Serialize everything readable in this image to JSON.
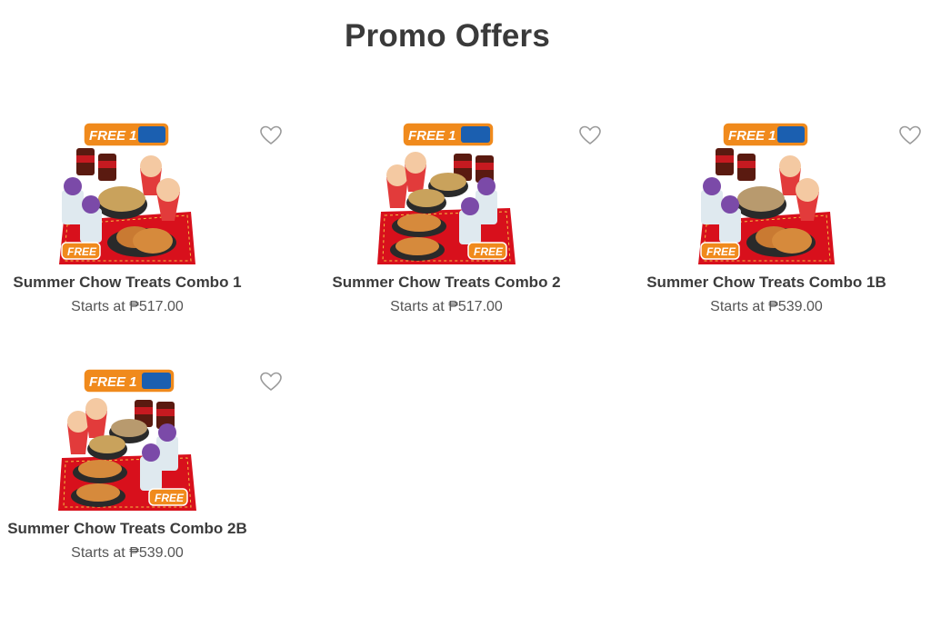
{
  "page": {
    "title": "Promo Offers"
  },
  "colors": {
    "title": "#3a3a3a",
    "text": "#3c3c3c",
    "price": "#555555",
    "heart": "#9a9a9a",
    "tray_red": "#d8101c",
    "badge_orange": "#f08a1c"
  },
  "products": [
    {
      "name": "Summer Chow Treats Combo 1",
      "price_text": "Starts at ₱517.00",
      "image_badge_top": "FREE 1",
      "image_badge_bottom": "FREE",
      "favorite_icon": "heart-outline-icon"
    },
    {
      "name": "Summer Chow Treats Combo 2",
      "price_text": "Starts at ₱517.00",
      "image_badge_top": "FREE 1",
      "image_badge_bottom": "FREE",
      "favorite_icon": "heart-outline-icon"
    },
    {
      "name": "Summer Chow Treats Combo 1B",
      "price_text": "Starts at ₱539.00",
      "image_badge_top": "FREE 1",
      "image_badge_bottom": "FREE",
      "favorite_icon": "heart-outline-icon"
    },
    {
      "name": "Summer Chow Treats Combo 2B",
      "price_text": "Starts at ₱539.00",
      "image_badge_top": "FREE 1",
      "image_badge_bottom": "FREE",
      "favorite_icon": "heart-outline-icon"
    }
  ]
}
